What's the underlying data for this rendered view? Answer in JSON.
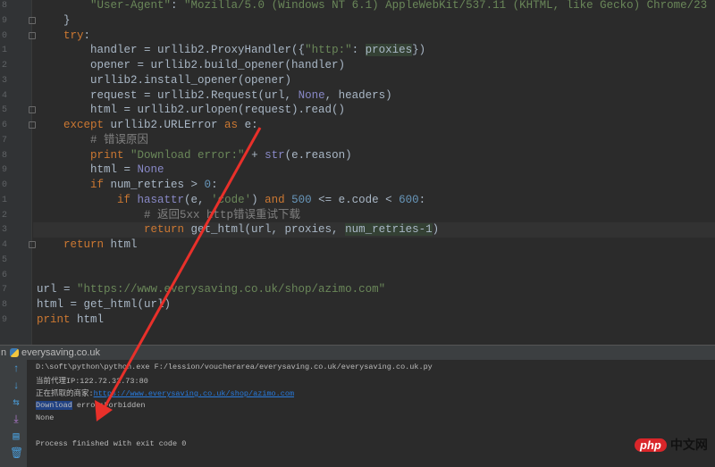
{
  "code": [
    {
      "ln": "8",
      "parts": [
        [
          "",
          "        "
        ],
        [
          "str",
          "\"User-Agent\""
        ],
        [
          "",
          ": "
        ],
        [
          "str",
          "\"Mozilla/5.0 (Windows NT 6.1) AppleWebKit/537.11 (KHTML, like Gecko) Chrome/23"
        ]
      ]
    },
    {
      "ln": "9",
      "parts": [
        [
          "",
          "    }"
        ]
      ]
    },
    {
      "ln": "0",
      "parts": [
        [
          "kw",
          "    try"
        ],
        [
          "",
          ":"
        ]
      ]
    },
    {
      "ln": "1",
      "parts": [
        [
          "",
          "        handler = urllib2.ProxyHandler({"
        ],
        [
          "str",
          "\"http:\""
        ],
        [
          "",
          ": "
        ],
        [
          "hl",
          "proxies"
        ],
        [
          "",
          "})"
        ]
      ]
    },
    {
      "ln": "2",
      "parts": [
        [
          "",
          "        opener = urllib2.build_opener(handler)"
        ]
      ]
    },
    {
      "ln": "3",
      "parts": [
        [
          "",
          "        urllib2.install_opener(opener)"
        ]
      ]
    },
    {
      "ln": "4",
      "parts": [
        [
          "",
          "        request = urllib2.Request(url, "
        ],
        [
          "none",
          "None"
        ],
        [
          "",
          ", headers)"
        ]
      ]
    },
    {
      "ln": "5",
      "parts": [
        [
          "",
          "        html = urllib2.urlopen(request).read()"
        ]
      ]
    },
    {
      "ln": "6",
      "parts": [
        [
          "kw",
          "    except"
        ],
        [
          "",
          " urllib2.URLError "
        ],
        [
          "kw",
          "as"
        ],
        [
          "",
          " e:"
        ]
      ]
    },
    {
      "ln": "7",
      "parts": [
        [
          "cmt",
          "        # 错误原因"
        ]
      ]
    },
    {
      "ln": "8",
      "parts": [
        [
          "kw",
          "        print "
        ],
        [
          "str",
          "\"Download error:\""
        ],
        [
          "",
          " + "
        ],
        [
          "bi",
          "str"
        ],
        [
          "",
          "(e.reason)"
        ]
      ]
    },
    {
      "ln": "9",
      "parts": [
        [
          "",
          "        html = "
        ],
        [
          "none",
          "None"
        ]
      ]
    },
    {
      "ln": "0",
      "parts": [
        [
          "kw",
          "        if"
        ],
        [
          "",
          " num_retries > "
        ],
        [
          "num",
          "0"
        ],
        [
          "",
          ":"
        ]
      ]
    },
    {
      "ln": "1",
      "parts": [
        [
          "kw",
          "            if "
        ],
        [
          "bi",
          "hasattr"
        ],
        [
          "",
          "(e, "
        ],
        [
          "str",
          "'code'"
        ],
        [
          "",
          ") "
        ],
        [
          "kw",
          "and "
        ],
        [
          "num",
          "500"
        ],
        [
          "",
          " <= e.code < "
        ],
        [
          "num",
          "600"
        ],
        [
          "",
          ":"
        ]
      ]
    },
    {
      "ln": "2",
      "parts": [
        [
          "cmt",
          "                # 返回5xx http错误重试下载"
        ]
      ]
    },
    {
      "ln": "3",
      "parts": [
        [
          "kw",
          "                return"
        ],
        [
          "",
          " get_html(url, proxies, "
        ],
        [
          "hl",
          "num_retries-1"
        ],
        [
          "",
          ")"
        ]
      ]
    },
    {
      "ln": "4",
      "parts": [
        [
          "kw",
          "    return"
        ],
        [
          "",
          " html"
        ]
      ]
    },
    {
      "ln": "5",
      "parts": [
        [
          "",
          ""
        ]
      ]
    },
    {
      "ln": "6",
      "parts": [
        [
          "",
          ""
        ]
      ]
    },
    {
      "ln": "7",
      "parts": [
        [
          "",
          "url = "
        ],
        [
          "str",
          "\"https://www.everysaving.co.uk/shop/azimo.com\""
        ]
      ]
    },
    {
      "ln": "8",
      "parts": [
        [
          "",
          "html = get_html(url)"
        ]
      ]
    },
    {
      "ln": "9",
      "parts": [
        [
          "kw",
          "print"
        ],
        [
          "",
          " html"
        ]
      ]
    }
  ],
  "run": {
    "tab_prefix": "n",
    "tab_label": "everysaving.co.uk"
  },
  "console": {
    "cmd": "D:\\soft\\python\\python.exe F:/lession/voucherarea/everysaving.co.uk/everysaving.co.uk.py",
    "proxy": "当前代理IP:122.72.32.73:80",
    "merchant_label": "正在抓取的商家:",
    "merchant_url": "https://www.everysaving.co.uk/shop/azimo.com",
    "err_word": "Download",
    "err_rest": " error:Forbidden",
    "none": "None",
    "exit": "Process finished with exit code 0"
  },
  "watermark": {
    "brand": "php",
    "text": "中文网"
  },
  "colors": {
    "arrow": "#e8302a"
  }
}
